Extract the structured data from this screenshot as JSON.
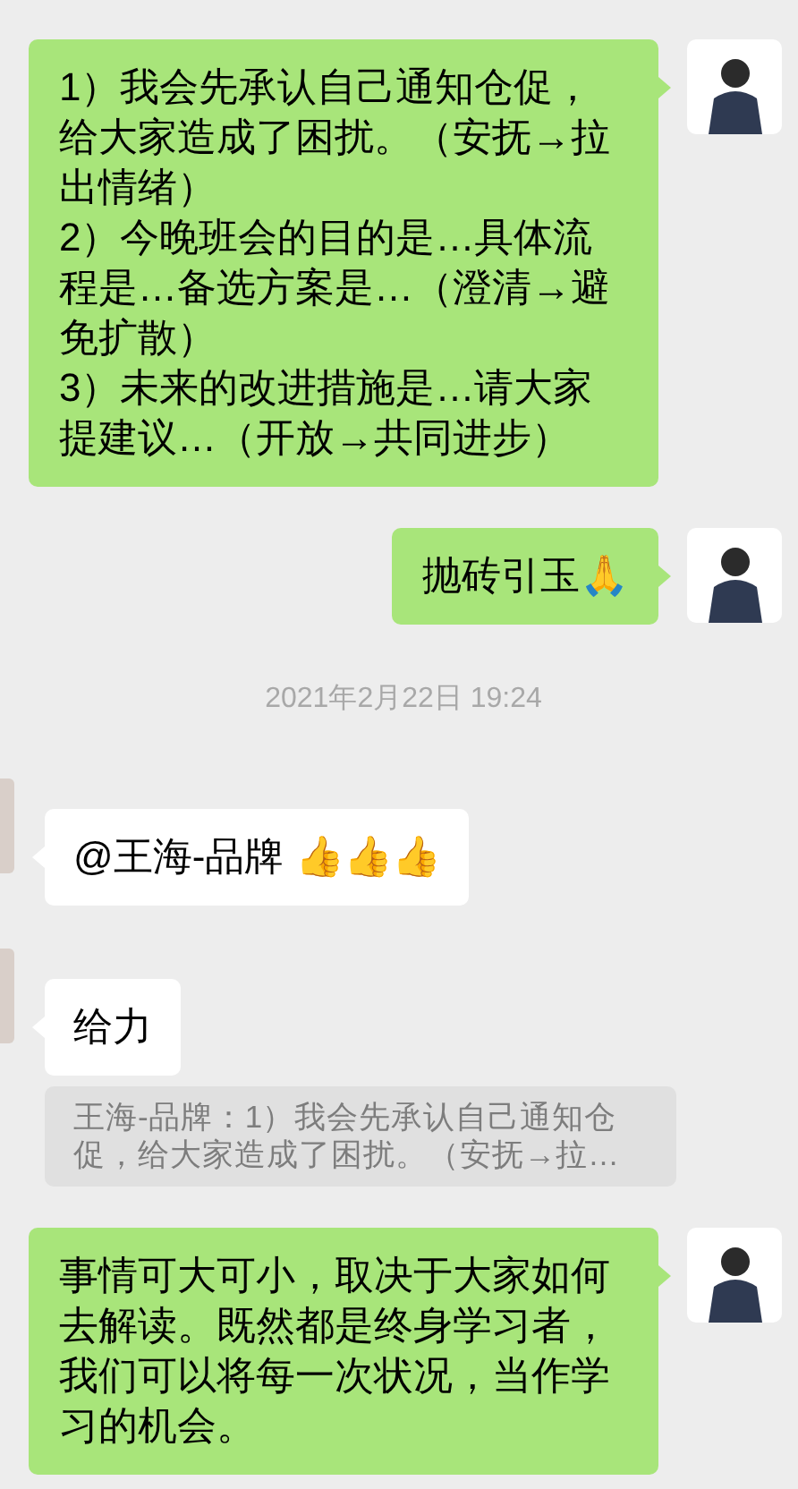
{
  "messages": [
    {
      "kind": "outgoing",
      "text": "1）我会先承认自己通知仓促，给大家造成了困扰。（安抚→拉出情绪）\n2）今晚班会的目的是…具体流程是…备选方案是…（澄清→避免扩散）\n3）未来的改进措施是…请大家提建议…（开放→共同进步）"
    },
    {
      "kind": "outgoing",
      "text": "抛砖引玉🙏"
    },
    {
      "kind": "time",
      "text": "2021年2月22日 19:24"
    },
    {
      "kind": "incoming",
      "text": "@王海-品牌 👍👍👍"
    },
    {
      "kind": "incoming",
      "text": "给力"
    },
    {
      "kind": "quote",
      "text": "王海-品牌：1）我会先承认自己通知仓促，给大家造成了困扰。（安抚→拉…"
    },
    {
      "kind": "outgoing",
      "text": "事情可大可小，取决于大家如何去解读。既然都是终身学习者，我们可以将每一次状况，当作学习的机会。"
    }
  ]
}
